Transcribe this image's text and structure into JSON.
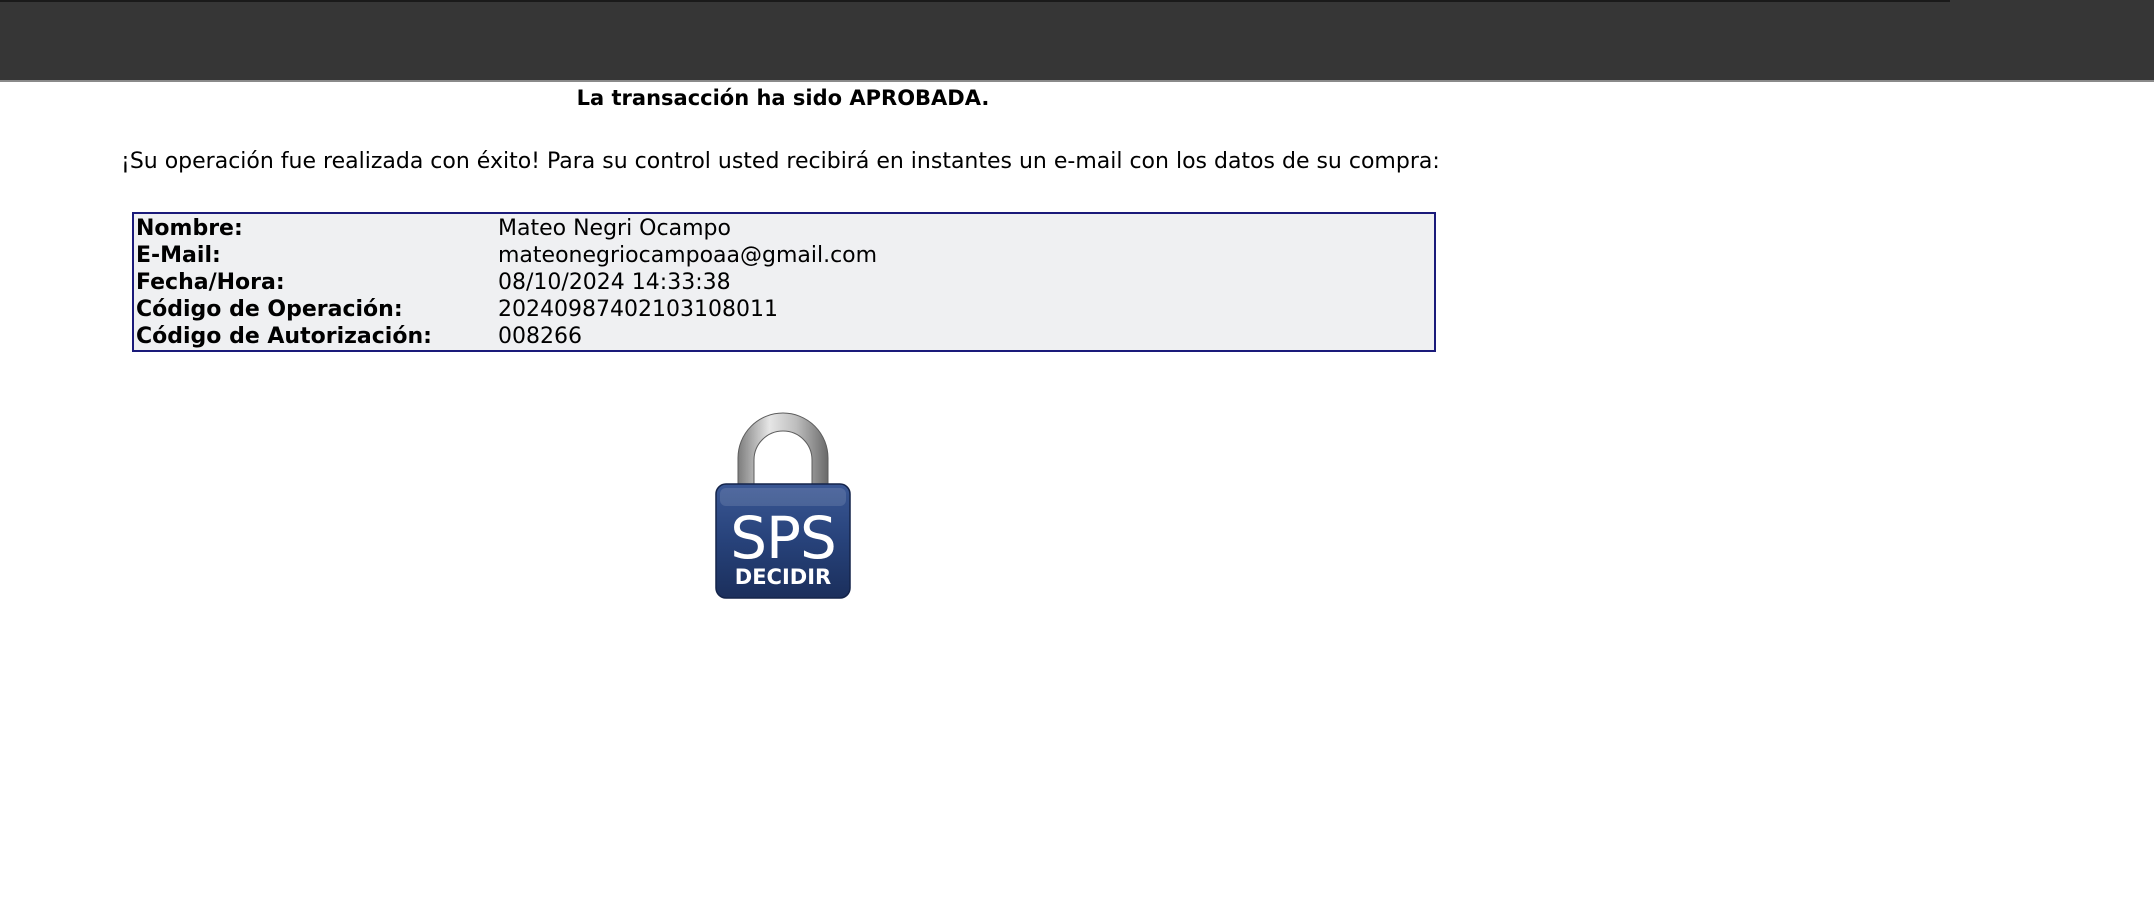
{
  "page": {
    "title": "La transacción ha sido APROBADA.",
    "message": "¡Su operación fue realizada con éxito! Para su control usted recibirá en instantes un e-mail con los datos de su compra:"
  },
  "details": [
    {
      "label": "Nombre:",
      "value": "Mateo Negri Ocampo"
    },
    {
      "label": "E-Mail:",
      "value": "mateonegriocampoaa@gmail.com"
    },
    {
      "label": "Fecha/Hora:",
      "value": "08/10/2024 14:33:38"
    },
    {
      "label": "Código de Operación:",
      "value": "20240987402103108011"
    },
    {
      "label": "Código de Autorización:",
      "value": "008266"
    }
  ],
  "badge": {
    "icon": "padlock-icon",
    "line1": "SPS",
    "line2": "DECIDIR",
    "color": "#1f3a6e"
  },
  "colors": {
    "topbar": "#363636",
    "table_border": "#1a1a7a",
    "table_background": "#eff0f2"
  }
}
